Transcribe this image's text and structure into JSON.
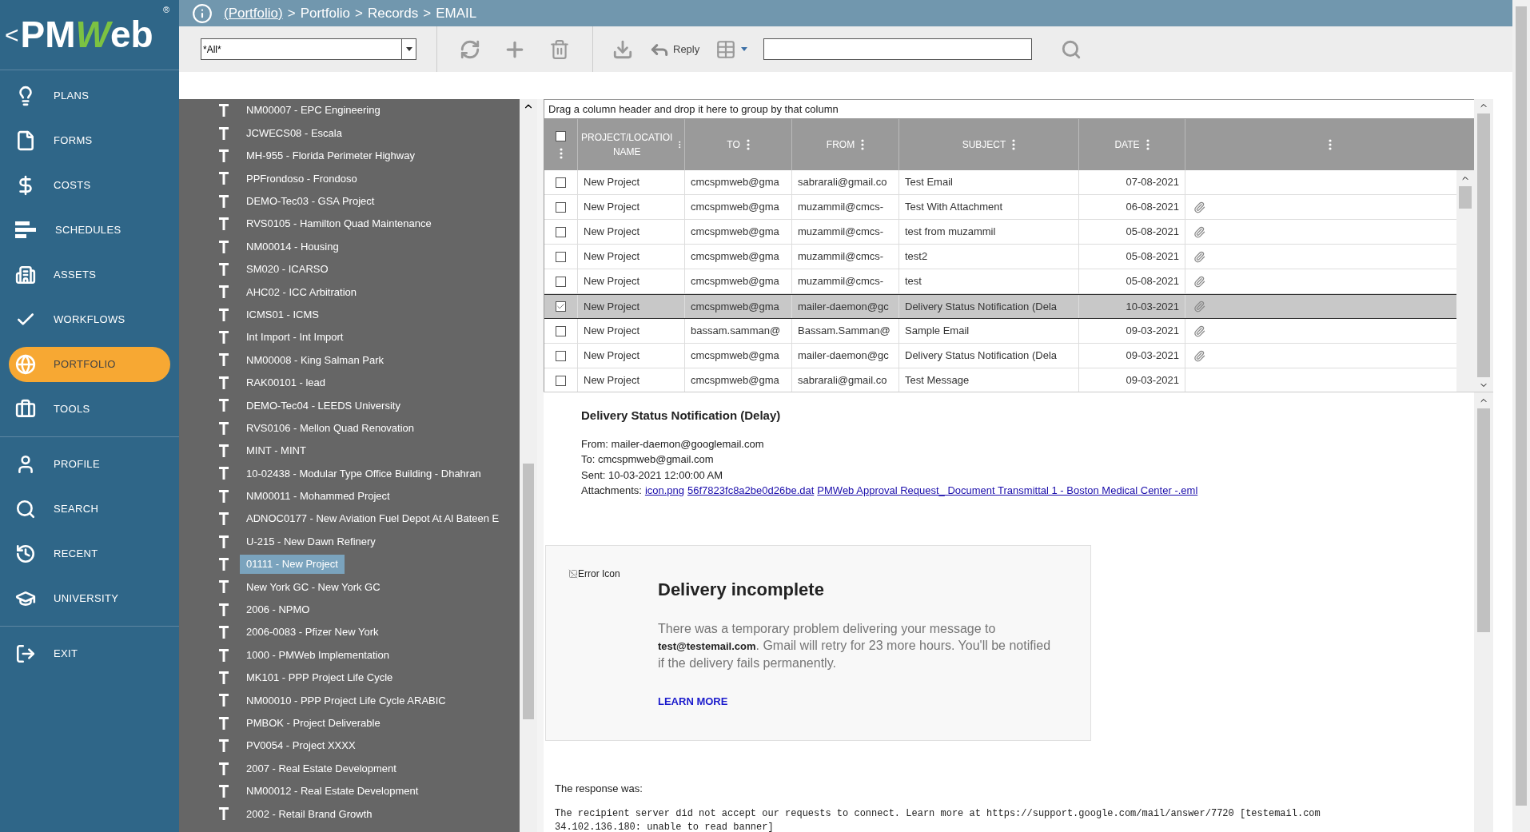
{
  "sidebar": {
    "logo": {
      "back": "<",
      "text_left": "PM",
      "text_accent": "W",
      "text_right": "eb",
      "mark": "®"
    },
    "sections": [
      {
        "items": [
          {
            "label": "PLANS",
            "selected": false
          },
          {
            "label": "FORMS",
            "selected": false
          },
          {
            "label": "COSTS",
            "selected": false
          },
          {
            "label": "SCHEDULES",
            "selected": false
          },
          {
            "label": "ASSETS",
            "selected": false
          },
          {
            "label": "WORKFLOWS",
            "selected": false
          },
          {
            "label": "PORTFOLIO",
            "selected": true
          },
          {
            "label": "TOOLS",
            "selected": false
          }
        ]
      },
      {
        "items": [
          {
            "label": "PROFILE",
            "selected": false
          },
          {
            "label": "SEARCH",
            "selected": false
          },
          {
            "label": "RECENT",
            "selected": false
          },
          {
            "label": "UNIVERSITY",
            "selected": false
          }
        ]
      },
      {
        "items": [
          {
            "label": "EXIT",
            "selected": false
          }
        ]
      }
    ]
  },
  "breadcrumb": {
    "separator": ">",
    "items": [
      {
        "label": "(Portfolio)",
        "link": true
      },
      {
        "label": "Portfolio",
        "link": false
      },
      {
        "label": "Records",
        "link": false
      },
      {
        "label": "EMAIL",
        "link": false
      }
    ]
  },
  "toolbar": {
    "filter": {
      "value": "*All*"
    },
    "reply": "Reply"
  },
  "tree": {
    "items": [
      {
        "label": "NM00007 - EPC Engineering",
        "selected": false
      },
      {
        "label": "JCWECS08 - Escala",
        "selected": false
      },
      {
        "label": "MH-955 - Florida Perimeter Highway",
        "selected": false
      },
      {
        "label": "PPFrondoso - Frondoso",
        "selected": false
      },
      {
        "label": "DEMO-Tec03 - GSA Project",
        "selected": false
      },
      {
        "label": "RVS0105 - Hamilton Quad Maintenance",
        "selected": false
      },
      {
        "label": "NM00014 - Housing",
        "selected": false
      },
      {
        "label": "SM020 - ICARSO",
        "selected": false
      },
      {
        "label": "AHC02 - ICC Arbitration",
        "selected": false
      },
      {
        "label": "ICMS01 - ICMS",
        "selected": false
      },
      {
        "label": "Int Import - Int Import",
        "selected": false
      },
      {
        "label": "NM00008 - King Salman Park",
        "selected": false
      },
      {
        "label": "RAK00101 - lead",
        "selected": false
      },
      {
        "label": "DEMO-Tec04 - LEEDS University",
        "selected": false
      },
      {
        "label": "RVS0106 - Mellon Quad Renovation",
        "selected": false
      },
      {
        "label": "MINT - MINT",
        "selected": false
      },
      {
        "label": "10-02438 - Modular Type Office Building - Dhahran",
        "selected": false
      },
      {
        "label": "NM00011 - Mohammed Project",
        "selected": false
      },
      {
        "label": "ADNOC0177 - New Aviation Fuel Depot At Al Bateen E",
        "selected": false
      },
      {
        "label": "U-215 - New Dawn Refinery",
        "selected": false
      },
      {
        "label": "01111 - New Project",
        "selected": true
      },
      {
        "label": "New York GC - New York GC",
        "selected": false
      },
      {
        "label": "2006 - NPMO",
        "selected": false
      },
      {
        "label": "2006-0083 - Pfizer New York",
        "selected": false
      },
      {
        "label": "1000 - PMWeb Implementation",
        "selected": false
      },
      {
        "label": "MK101 - PPP Project Life Cycle",
        "selected": false
      },
      {
        "label": "NM00010 - PPP Project Life Cycle ARABIC",
        "selected": false
      },
      {
        "label": "PMBOK - Project Deliverable",
        "selected": false
      },
      {
        "label": "PV0054 - Project XXXX",
        "selected": false
      },
      {
        "label": "2007 - Real Estate Development",
        "selected": false
      },
      {
        "label": "NM00012 - Real Estate Development",
        "selected": false
      },
      {
        "label": "2002 - Retail Brand Growth",
        "selected": false
      }
    ]
  },
  "grid": {
    "group_hint": "Drag a column header and drop it here to group by that column",
    "select_all": {
      "checked": false
    },
    "columns": [
      "PROJECT/LOCATIOI NAME",
      "TO",
      "FROM",
      "SUBJECT",
      "DATE"
    ],
    "rows": [
      {
        "project": "New Project",
        "to": "cmcspmweb@gma",
        "from": "sabrarali@gmail.co",
        "subject": "Test Email",
        "date": "07-08-2021",
        "attachment": false,
        "checked": false,
        "selected": false
      },
      {
        "project": "New Project",
        "to": "cmcspmweb@gma",
        "from": "muzammil@cmcs-",
        "subject": "Test With Attachment",
        "date": "06-08-2021",
        "attachment": true,
        "checked": false,
        "selected": false
      },
      {
        "project": "New Project",
        "to": "cmcspmweb@gma",
        "from": "muzammil@cmcs-",
        "subject": "test from muzammil",
        "date": "05-08-2021",
        "attachment": true,
        "checked": false,
        "selected": false
      },
      {
        "project": "New Project",
        "to": "cmcspmweb@gma",
        "from": "muzammil@cmcs-",
        "subject": "test2",
        "date": "05-08-2021",
        "attachment": true,
        "checked": false,
        "selected": false
      },
      {
        "project": "New Project",
        "to": "cmcspmweb@gma",
        "from": "muzammil@cmcs-",
        "subject": "test",
        "date": "05-08-2021",
        "attachment": true,
        "checked": false,
        "selected": false
      },
      {
        "project": "New Project",
        "to": "cmcspmweb@gma",
        "from": "mailer-daemon@gc",
        "subject": "Delivery Status Notification (Dela",
        "date": "10-03-2021",
        "attachment": true,
        "checked": true,
        "selected": true
      },
      {
        "project": "New Project",
        "to": "bassam.samman@",
        "from": "Bassam.Samman@",
        "subject": "Sample Email",
        "date": "09-03-2021",
        "attachment": true,
        "checked": false,
        "selected": false
      },
      {
        "project": "New Project",
        "to": "cmcspmweb@gma",
        "from": "mailer-daemon@gc",
        "subject": "Delivery Status Notification (Dela",
        "date": "09-03-2021",
        "attachment": true,
        "checked": false,
        "selected": false
      },
      {
        "project": "New Project",
        "to": "cmcspmweb@gma",
        "from": "sabrarali@gmail.co",
        "subject": "Test Message",
        "date": "09-03-2021",
        "attachment": false,
        "checked": false,
        "selected": false
      }
    ]
  },
  "preview": {
    "subject": "Delivery Status Notification (Delay)",
    "from": "From: mailer-daemon@googlemail.com",
    "to": "To: cmcspmweb@gmail.com",
    "sent": "Sent: 10-03-2021 12:00:00 AM",
    "attachments_label": "Attachments:",
    "attachments": [
      "icon.png",
      "56f7823fc8a2be0d26be.dat",
      "PMWeb Approval Request_ Document Transmittal 1 - Boston Medical Center -.eml"
    ],
    "card": {
      "image_alt": "Error Icon",
      "title": "Delivery incomplete",
      "message": "There was a temporary problem delivering your message to **test@testemail.com**. Gmail will retry for 23 more hours. You'll be notified if the delivery fails permanently.",
      "link": "LEARN MORE"
    },
    "response_label": "The response was:",
    "response": "The recipient server did not accept our requests to connect. Learn more at https://support.google.com/mail/answer/7720 [testemail.com\n34.102.136.180: unable to read banner]"
  }
}
